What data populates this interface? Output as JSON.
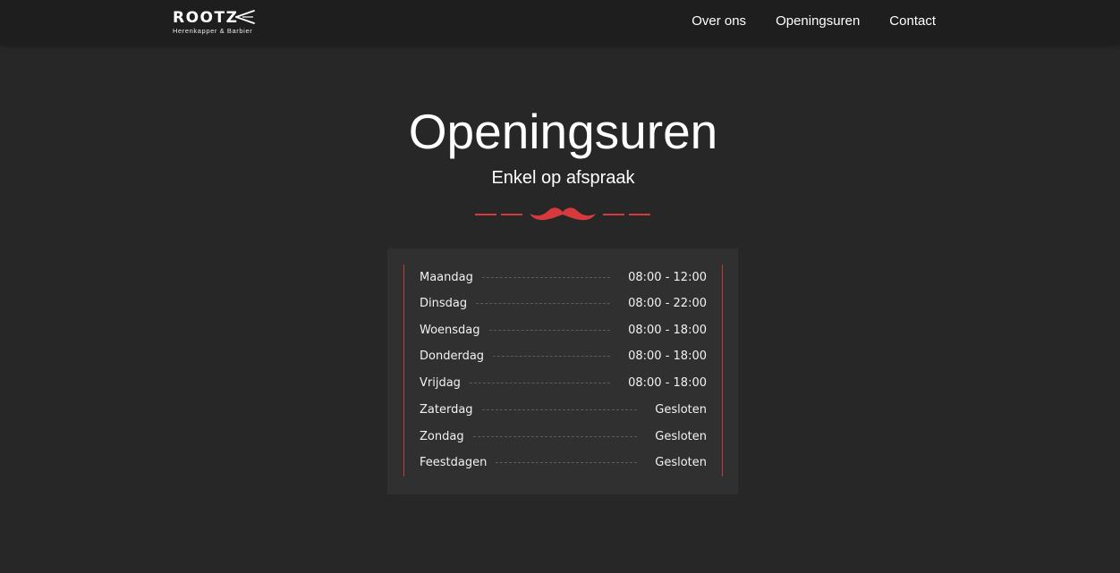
{
  "brand": {
    "name": "ROOTZ",
    "tagline": "Herenkapper & Barbier",
    "icon": "scissors-icon"
  },
  "nav": {
    "links": [
      {
        "label": "Over ons"
      },
      {
        "label": "Openingsuren"
      },
      {
        "label": "Contact"
      }
    ]
  },
  "section": {
    "title": "Openingsuren",
    "subtitle": "Enkel op afspraak",
    "divider_icon": "moustache-icon"
  },
  "hours": [
    {
      "day": "Maandag",
      "time": "08:00 - 12:00"
    },
    {
      "day": "Dinsdag",
      "time": "08:00 - 22:00"
    },
    {
      "day": "Woensdag",
      "time": "08:00 - 18:00"
    },
    {
      "day": "Donderdag",
      "time": "08:00 - 18:00"
    },
    {
      "day": "Vrijdag",
      "time": "08:00 - 18:00"
    },
    {
      "day": "Zaterdag",
      "time": "Gesloten"
    },
    {
      "day": "Zondag",
      "time": "Gesloten"
    },
    {
      "day": "Feestdagen",
      "time": "Gesloten"
    }
  ],
  "colors": {
    "accent": "#d63a3c",
    "background": "#272727",
    "navbar": "#1e1e1e",
    "card": "#303030"
  }
}
